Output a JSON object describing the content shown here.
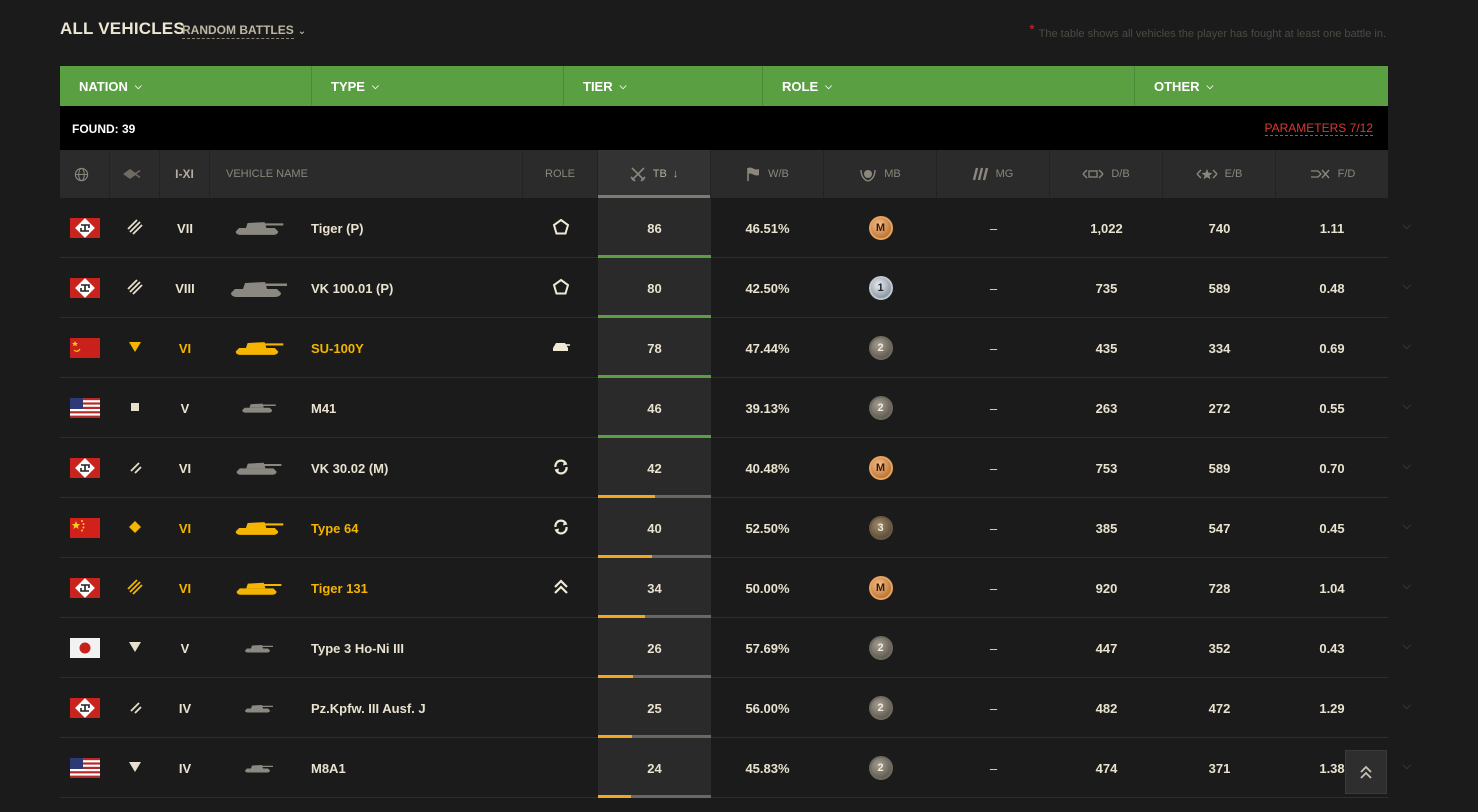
{
  "header": {
    "title": "ALL VEHICLES",
    "mode": "RANDOM BATTLES",
    "note_star": "*",
    "note": "The table shows all vehicles the player has fought at least one battle in."
  },
  "filters": [
    {
      "label": "NATION"
    },
    {
      "label": "TYPE"
    },
    {
      "label": "TIER"
    },
    {
      "label": "ROLE"
    },
    {
      "label": "OTHER"
    }
  ],
  "found": {
    "label": "FOUND: 39",
    "parameters": "PARAMETERS 7/12"
  },
  "columns": {
    "tier": "I-XI",
    "vehicle_name": "VEHICLE NAME",
    "role": "ROLE",
    "tb": "TB",
    "sort_arrow": "↓",
    "wb": "W/B",
    "mb": "MB",
    "mg": "MG",
    "db": "D/B",
    "eb": "E/B",
    "fd": "F/D"
  },
  "colors": {
    "accent_green": "#5aa042",
    "progress_green": "#5aa042",
    "progress_orange": "#f1a81c",
    "premium_gold": "#f4b400",
    "params_red": "#d83a32"
  },
  "rows": [
    {
      "nation": "germany",
      "type": "heavy",
      "tier": "VII",
      "name": "Tiger (P)",
      "premium": false,
      "role": "pentagon-icon",
      "tb": "86",
      "tb_fill": 1.0,
      "tb_color": "green",
      "wb": "46.51%",
      "mb": "M",
      "mb_kind": "m",
      "mg": "–",
      "db": "1,022",
      "eb": "740",
      "fd": "1.11"
    },
    {
      "nation": "germany",
      "type": "heavy",
      "tier": "VIII",
      "name": "VK 100.01 (P)",
      "premium": false,
      "role": "pentagon-icon",
      "tb": "80",
      "tb_fill": 1.0,
      "tb_color": "green",
      "wb": "42.50%",
      "mb": "1",
      "mb_kind": "c1",
      "mg": "–",
      "db": "735",
      "eb": "589",
      "fd": "0.48"
    },
    {
      "nation": "ussr",
      "type": "td",
      "tier": "VI",
      "name": "SU-100Y",
      "premium": true,
      "role": "td-role-icon",
      "tb": "78",
      "tb_fill": 1.0,
      "tb_color": "green",
      "wb": "47.44%",
      "mb": "2",
      "mb_kind": "c2",
      "mg": "–",
      "db": "435",
      "eb": "334",
      "fd": "0.69"
    },
    {
      "nation": "usa",
      "type": "light",
      "tier": "V",
      "name": "M41",
      "premium": false,
      "role": "",
      "tb": "46",
      "tb_fill": 1.0,
      "tb_color": "green",
      "wb": "39.13%",
      "mb": "2",
      "mb_kind": "c2",
      "mg": "–",
      "db": "263",
      "eb": "272",
      "fd": "0.55"
    },
    {
      "nation": "germany",
      "type": "medium",
      "tier": "VI",
      "name": "VK 30.02 (M)",
      "premium": false,
      "role": "circle-arrows-icon",
      "tb": "42",
      "tb_fill": 0.5,
      "tb_color": "orange",
      "wb": "40.48%",
      "mb": "M",
      "mb_kind": "m",
      "mg": "–",
      "db": "753",
      "eb": "589",
      "fd": "0.70"
    },
    {
      "nation": "china",
      "type": "light",
      "tier": "VI",
      "name": "Type 64",
      "premium": true,
      "role": "circle-arrows-icon",
      "tb": "40",
      "tb_fill": 0.48,
      "tb_color": "orange",
      "wb": "52.50%",
      "mb": "3",
      "mb_kind": "c3",
      "mg": "–",
      "db": "385",
      "eb": "547",
      "fd": "0.45"
    },
    {
      "nation": "germany",
      "type": "heavy",
      "tier": "VI",
      "name": "Tiger 131",
      "premium": true,
      "role": "double-chevron-up-icon",
      "tb": "34",
      "tb_fill": 0.42,
      "tb_color": "orange",
      "wb": "50.00%",
      "mb": "M",
      "mb_kind": "m",
      "mg": "–",
      "db": "920",
      "eb": "728",
      "fd": "1.04"
    },
    {
      "nation": "japan",
      "type": "td",
      "tier": "V",
      "name": "Type 3 Ho-Ni III",
      "premium": false,
      "role": "",
      "tb": "26",
      "tb_fill": 0.31,
      "tb_color": "orange",
      "wb": "57.69%",
      "mb": "2",
      "mb_kind": "c2",
      "mg": "–",
      "db": "447",
      "eb": "352",
      "fd": "0.43"
    },
    {
      "nation": "germany",
      "type": "medium",
      "tier": "IV",
      "name": "Pz.Kpfw. III Ausf. J",
      "premium": false,
      "role": "",
      "tb": "25",
      "tb_fill": 0.3,
      "tb_color": "orange",
      "wb": "56.00%",
      "mb": "2",
      "mb_kind": "c2",
      "mg": "–",
      "db": "482",
      "eb": "472",
      "fd": "1.29"
    },
    {
      "nation": "usa",
      "type": "td",
      "tier": "IV",
      "name": "M8A1",
      "premium": false,
      "role": "",
      "tb": "24",
      "tb_fill": 0.29,
      "tb_color": "orange",
      "wb": "45.83%",
      "mb": "2",
      "mb_kind": "c2",
      "mg": "–",
      "db": "474",
      "eb": "371",
      "fd": "1.38"
    }
  ],
  "scroll_top_icon": "double-chevron-up-icon"
}
